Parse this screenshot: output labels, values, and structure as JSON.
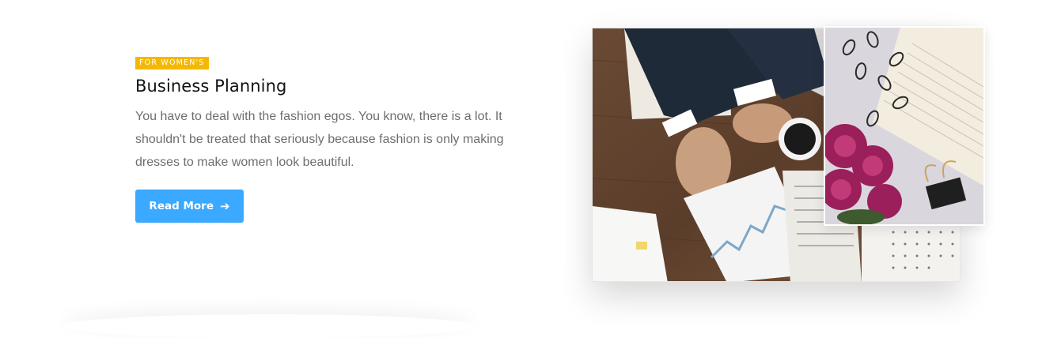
{
  "card": {
    "badge": "FOR WOMEN'S",
    "title": "Business Planning",
    "description": "You have to deal with the fashion egos. You know, there is a lot. It shouldn't be treated that seriously because fashion is only making dresses to make women look beautiful.",
    "button_label": "Read More",
    "button_icon": "arrow-right-icon"
  },
  "colors": {
    "badge_bg": "#f5b800",
    "button_bg": "#3aa9ff",
    "title": "#111111",
    "body_text": "#6e6e6e"
  },
  "images": {
    "main": "business-desk-photo",
    "secondary": "flowers-notebook-paperclips-photo"
  }
}
